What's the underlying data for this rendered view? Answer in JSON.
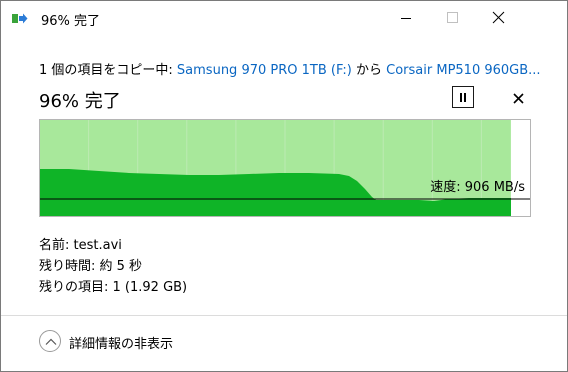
{
  "window": {
    "title": "96% 完了"
  },
  "copy_status": {
    "prefix": "1 個の項目をコピー中: ",
    "source": "Samsung 970 PRO 1TB (F:)",
    "middle": " から ",
    "destination": "Corsair MP510 960GB..."
  },
  "progress": {
    "percent_label": "96% 完了",
    "percent": 96
  },
  "graph": {
    "speed_label": "速度: 906 MB/s",
    "progress_fraction": 0.96,
    "colors": {
      "completed_bg": "#a8e89b",
      "remaining_bg": "#ffffff",
      "speed_fill": "#0fb427",
      "border": "#b5b5b5",
      "speed_line": "#000000"
    }
  },
  "details": {
    "name_label": "名前: ",
    "name_value": "test.avi",
    "time_label": "残り時間: ",
    "time_value": "約 5 秒",
    "items_label": "残りの項目: ",
    "items_value": "1 (1.92 GB)"
  },
  "footer": {
    "less_details": "詳細情報の非表示"
  }
}
